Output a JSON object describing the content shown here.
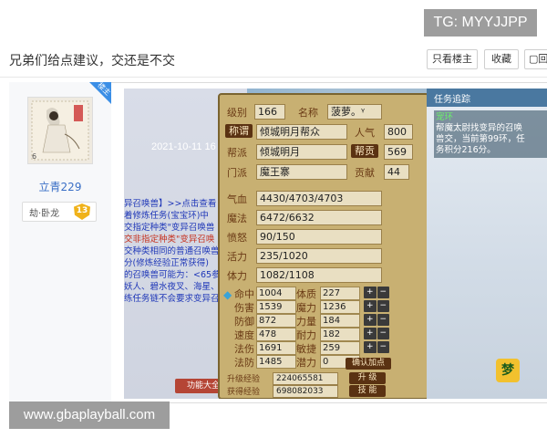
{
  "watermarks": {
    "top": "TG: MYYJJPP",
    "bottom": "www.gbaplayball.com"
  },
  "thread": {
    "title": "兄弟们给点建议，交还是不交",
    "actions": {
      "only_op": "只看楼主",
      "favorite": "收藏",
      "reply": "回复"
    }
  },
  "author": {
    "badge": "楼主",
    "stamp_number": "6",
    "username": "立青229",
    "rank_label": "劫·卧龙",
    "rank_level": "13"
  },
  "photo": {
    "left_screen": {
      "date": "2021-10-11 16",
      "lines": [
        {
          "text": "异召唤兽】>>点击查看",
          "cls": ""
        },
        {
          "text": "着修炼任务(宝宝环)中",
          "cls": ""
        },
        {
          "text": "交指定种类\"变异召唤兽",
          "cls": ""
        },
        {
          "text": "交非指定种类\"变异召唤",
          "cls": "red"
        },
        {
          "text": "交种类相同的普通召唤兽",
          "cls": ""
        },
        {
          "text": "分(修炼经验正常获得)",
          "cls": ""
        },
        {
          "text": "的召唤兽可能为：<65参",
          "cls": ""
        },
        {
          "text": "妖人、碧水夜叉、海星、狸",
          "cls": ""
        },
        {
          "text": "练任务链不会要求变异召唤兽",
          "cls": ""
        }
      ],
      "button": "功能大全"
    },
    "panel": {
      "level_label": "级别",
      "level_value": "166",
      "name_label": "名称",
      "name_value": "菠萝。ᵞ",
      "title_label": "称谓",
      "title_value": "倾城明月帮众",
      "popularity_label": "人气",
      "popularity_value": "800",
      "gang_label": "帮派",
      "gang_value": "倾城明月",
      "contribution_tag": "帮贡",
      "contribution_value": "569",
      "sect_label": "门派",
      "sect_value": "魔王寨",
      "merit_label": "贡献",
      "merit_value": "44",
      "hp_label": "气血",
      "hp_value": "4430/4703/4703",
      "mp_label": "魔法",
      "mp_value": "6472/6632",
      "anger_label": "愤怒",
      "anger_value": "90/150",
      "vitality_label": "活力",
      "vitality_value": "235/1020",
      "stamina_label": "体力",
      "stamina_value": "1082/1108",
      "stats_left": [
        {
          "label": "命中",
          "value": "1004"
        },
        {
          "label": "伤害",
          "value": "1539"
        },
        {
          "label": "防御",
          "value": "872"
        },
        {
          "label": "速度",
          "value": "478"
        },
        {
          "label": "法伤",
          "value": "1691"
        },
        {
          "label": "法防",
          "value": "1485"
        }
      ],
      "stats_right": [
        {
          "label": "体质",
          "value": "227"
        },
        {
          "label": "魔力",
          "value": "1236"
        },
        {
          "label": "力量",
          "value": "184"
        },
        {
          "label": "耐力",
          "value": "182"
        },
        {
          "label": "敏捷",
          "value": "259"
        },
        {
          "label": "潜力",
          "value": "0"
        }
      ],
      "confirm_points": "确认加点",
      "exp_rows": [
        {
          "label": "升级经验",
          "value": "224065581",
          "btn": "升 级"
        },
        {
          "label": "获得经验",
          "value": "698082033",
          "btn": "技 能"
        }
      ]
    },
    "right_screen": {
      "top_text": "任务追踪",
      "heading": "宠环",
      "lines": [
        "帮魔太尉找变异的召唤",
        "兽交，当前第99环，任",
        "务积分216分。"
      ],
      "icon": "梦"
    }
  },
  "colors": {
    "link_blue": "#3a6fc6",
    "badge_blue": "#3a8ee6",
    "panel_tan": "#c8b072"
  }
}
